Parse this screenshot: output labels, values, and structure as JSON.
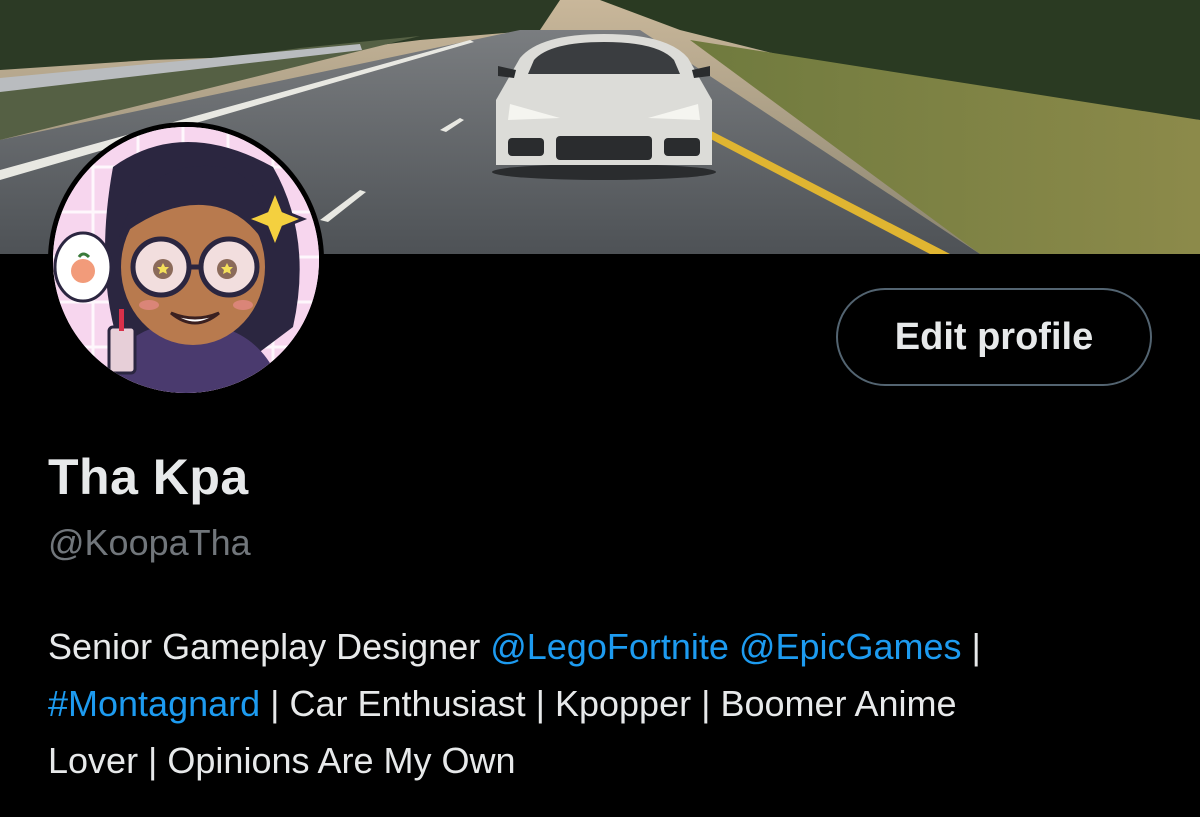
{
  "colors": {
    "background": "#000000",
    "text_primary": "#e7e9ea",
    "text_secondary": "#71767b",
    "link": "#1d9bf0",
    "button_border": "#536471"
  },
  "banner": {
    "image": "white-sports-car-on-highway-photo"
  },
  "avatar": {
    "image": "cartoon-girl-with-glasses-avatar"
  },
  "actions": {
    "edit_profile_label": "Edit profile"
  },
  "profile": {
    "display_name": "Tha Kpa",
    "handle": "@KoopaTha"
  },
  "bio": {
    "line1_text": "Senior Gameplay Designer ",
    "mention1": "@LegoFortnite",
    "space1": " ",
    "mention2": "@EpicGames",
    "line1_tail": " |",
    "hashtag1": "#Montagnard",
    "line2_text": " | Car Enthusiast | Kpopper | Boomer Anime",
    "line3_text": "Lover | Opinions Are My Own"
  }
}
